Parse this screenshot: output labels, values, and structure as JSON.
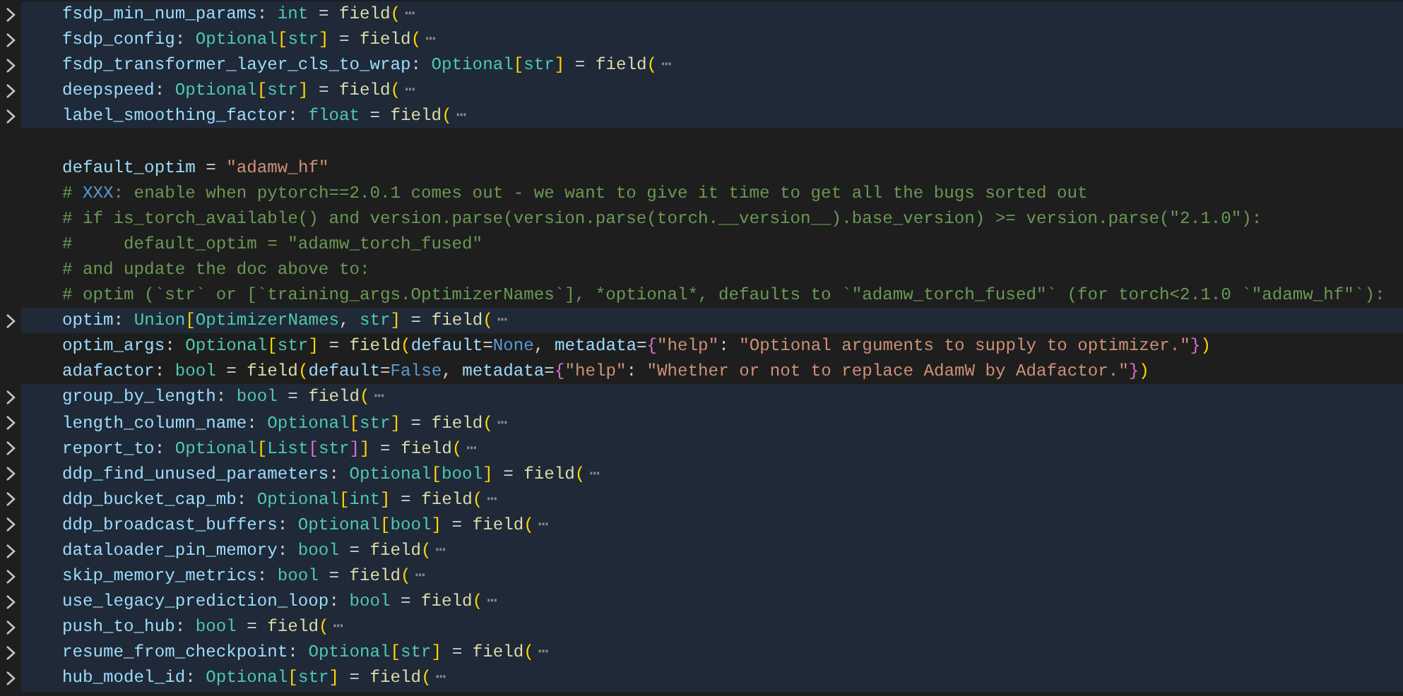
{
  "lines": [
    {
      "folded": true,
      "tokens": [
        {
          "kind": "v",
          "t": "fsdp_min_num_params"
        },
        {
          "kind": "o",
          "t": ": "
        },
        {
          "kind": "t",
          "t": "int"
        },
        {
          "kind": "o",
          "t": " = "
        },
        {
          "kind": "f",
          "t": "field"
        },
        {
          "kind": "b1",
          "t": "("
        },
        {
          "kind": "e",
          "t": "⋯"
        }
      ]
    },
    {
      "folded": true,
      "tokens": [
        {
          "kind": "v",
          "t": "fsdp_config"
        },
        {
          "kind": "o",
          "t": ": "
        },
        {
          "kind": "t",
          "t": "Optional"
        },
        {
          "kind": "b1",
          "t": "["
        },
        {
          "kind": "t",
          "t": "str"
        },
        {
          "kind": "b1",
          "t": "]"
        },
        {
          "kind": "o",
          "t": " = "
        },
        {
          "kind": "f",
          "t": "field"
        },
        {
          "kind": "b1",
          "t": "("
        },
        {
          "kind": "e",
          "t": "⋯"
        }
      ]
    },
    {
      "folded": true,
      "tokens": [
        {
          "kind": "v",
          "t": "fsdp_transformer_layer_cls_to_wrap"
        },
        {
          "kind": "o",
          "t": ": "
        },
        {
          "kind": "t",
          "t": "Optional"
        },
        {
          "kind": "b1",
          "t": "["
        },
        {
          "kind": "t",
          "t": "str"
        },
        {
          "kind": "b1",
          "t": "]"
        },
        {
          "kind": "o",
          "t": " = "
        },
        {
          "kind": "f",
          "t": "field"
        },
        {
          "kind": "b1",
          "t": "("
        },
        {
          "kind": "e",
          "t": "⋯"
        }
      ]
    },
    {
      "folded": true,
      "tokens": [
        {
          "kind": "v",
          "t": "deepspeed"
        },
        {
          "kind": "o",
          "t": ": "
        },
        {
          "kind": "t",
          "t": "Optional"
        },
        {
          "kind": "b1",
          "t": "["
        },
        {
          "kind": "t",
          "t": "str"
        },
        {
          "kind": "b1",
          "t": "]"
        },
        {
          "kind": "o",
          "t": " = "
        },
        {
          "kind": "f",
          "t": "field"
        },
        {
          "kind": "b1",
          "t": "("
        },
        {
          "kind": "e",
          "t": "⋯"
        }
      ]
    },
    {
      "folded": true,
      "tokens": [
        {
          "kind": "v",
          "t": "label_smoothing_factor"
        },
        {
          "kind": "o",
          "t": ": "
        },
        {
          "kind": "t",
          "t": "float"
        },
        {
          "kind": "o",
          "t": " = "
        },
        {
          "kind": "f",
          "t": "field"
        },
        {
          "kind": "b1",
          "t": "("
        },
        {
          "kind": "e",
          "t": "⋯"
        }
      ]
    },
    {
      "folded": false
    },
    {
      "folded": false,
      "tokens": [
        {
          "kind": "v",
          "t": "default_optim"
        },
        {
          "kind": "o",
          "t": " = "
        },
        {
          "kind": "s",
          "t": "\"adamw_hf\""
        }
      ]
    },
    {
      "folded": false,
      "tokens": [
        {
          "kind": "c",
          "t": "# "
        },
        {
          "kind": "tag",
          "t": "XXX"
        },
        {
          "kind": "c",
          "t": ": enable when pytorch==2.0.1 comes out - we want to give it time to get all the bugs sorted out"
        }
      ]
    },
    {
      "folded": false,
      "tokens": [
        {
          "kind": "c",
          "t": "# if is_torch_available() and version.parse(version.parse(torch.__version__).base_version) >= version.parse(\"2.1.0\"):"
        }
      ]
    },
    {
      "folded": false,
      "tokens": [
        {
          "kind": "c",
          "t": "#     default_optim = \"adamw_torch_fused\""
        }
      ]
    },
    {
      "folded": false,
      "tokens": [
        {
          "kind": "c",
          "t": "# and update the doc above to:"
        }
      ]
    },
    {
      "folded": false,
      "tokens": [
        {
          "kind": "c",
          "t": "# optim (`str` or [`training_args.OptimizerNames`], *optional*, defaults to `\"adamw_torch_fused\"` (for torch<2.1.0 `\"adamw_hf\"`):"
        }
      ]
    },
    {
      "folded": true,
      "tokens": [
        {
          "kind": "v",
          "t": "optim"
        },
        {
          "kind": "o",
          "t": ": "
        },
        {
          "kind": "t",
          "t": "Union"
        },
        {
          "kind": "b1",
          "t": "["
        },
        {
          "kind": "t",
          "t": "OptimizerNames"
        },
        {
          "kind": "o",
          "t": ", "
        },
        {
          "kind": "t",
          "t": "str"
        },
        {
          "kind": "b1",
          "t": "]"
        },
        {
          "kind": "o",
          "t": " = "
        },
        {
          "kind": "f",
          "t": "field"
        },
        {
          "kind": "b1",
          "t": "("
        },
        {
          "kind": "e",
          "t": "⋯"
        }
      ]
    },
    {
      "folded": false,
      "tokens": [
        {
          "kind": "v",
          "t": "optim_args"
        },
        {
          "kind": "o",
          "t": ": "
        },
        {
          "kind": "t",
          "t": "Optional"
        },
        {
          "kind": "b1",
          "t": "["
        },
        {
          "kind": "t",
          "t": "str"
        },
        {
          "kind": "b1",
          "t": "]"
        },
        {
          "kind": "o",
          "t": " = "
        },
        {
          "kind": "f",
          "t": "field"
        },
        {
          "kind": "b1",
          "t": "("
        },
        {
          "kind": "v",
          "t": "default"
        },
        {
          "kind": "o",
          "t": "="
        },
        {
          "kind": "kw",
          "t": "None"
        },
        {
          "kind": "o",
          "t": ", "
        },
        {
          "kind": "v",
          "t": "metadata"
        },
        {
          "kind": "o",
          "t": "="
        },
        {
          "kind": "b2",
          "t": "{"
        },
        {
          "kind": "s",
          "t": "\"help\""
        },
        {
          "kind": "o",
          "t": ": "
        },
        {
          "kind": "s",
          "t": "\"Optional arguments to supply to optimizer.\""
        },
        {
          "kind": "b2",
          "t": "}"
        },
        {
          "kind": "b1",
          "t": ")"
        }
      ]
    },
    {
      "folded": false,
      "tokens": [
        {
          "kind": "v",
          "t": "adafactor"
        },
        {
          "kind": "o",
          "t": ": "
        },
        {
          "kind": "t",
          "t": "bool"
        },
        {
          "kind": "o",
          "t": " = "
        },
        {
          "kind": "f",
          "t": "field"
        },
        {
          "kind": "b1",
          "t": "("
        },
        {
          "kind": "v",
          "t": "default"
        },
        {
          "kind": "o",
          "t": "="
        },
        {
          "kind": "kw",
          "t": "False"
        },
        {
          "kind": "o",
          "t": ", "
        },
        {
          "kind": "v",
          "t": "metadata"
        },
        {
          "kind": "o",
          "t": "="
        },
        {
          "kind": "b2",
          "t": "{"
        },
        {
          "kind": "s",
          "t": "\"help\""
        },
        {
          "kind": "o",
          "t": ": "
        },
        {
          "kind": "s",
          "t": "\"Whether or not to replace AdamW by Adafactor.\""
        },
        {
          "kind": "b2",
          "t": "}"
        },
        {
          "kind": "b1",
          "t": ")"
        }
      ]
    },
    {
      "folded": true,
      "tokens": [
        {
          "kind": "v",
          "t": "group_by_length"
        },
        {
          "kind": "o",
          "t": ": "
        },
        {
          "kind": "t",
          "t": "bool"
        },
        {
          "kind": "o",
          "t": " = "
        },
        {
          "kind": "f",
          "t": "field"
        },
        {
          "kind": "b1",
          "t": "("
        },
        {
          "kind": "e",
          "t": "⋯"
        }
      ]
    },
    {
      "folded": true,
      "tokens": [
        {
          "kind": "v",
          "t": "length_column_name"
        },
        {
          "kind": "o",
          "t": ": "
        },
        {
          "kind": "t",
          "t": "Optional"
        },
        {
          "kind": "b1",
          "t": "["
        },
        {
          "kind": "t",
          "t": "str"
        },
        {
          "kind": "b1",
          "t": "]"
        },
        {
          "kind": "o",
          "t": " = "
        },
        {
          "kind": "f",
          "t": "field"
        },
        {
          "kind": "b1",
          "t": "("
        },
        {
          "kind": "e",
          "t": "⋯"
        }
      ]
    },
    {
      "folded": true,
      "tokens": [
        {
          "kind": "v",
          "t": "report_to"
        },
        {
          "kind": "o",
          "t": ": "
        },
        {
          "kind": "t",
          "t": "Optional"
        },
        {
          "kind": "b1",
          "t": "["
        },
        {
          "kind": "t",
          "t": "List"
        },
        {
          "kind": "b2",
          "t": "["
        },
        {
          "kind": "t",
          "t": "str"
        },
        {
          "kind": "b2",
          "t": "]"
        },
        {
          "kind": "b1",
          "t": "]"
        },
        {
          "kind": "o",
          "t": " = "
        },
        {
          "kind": "f",
          "t": "field"
        },
        {
          "kind": "b1",
          "t": "("
        },
        {
          "kind": "e",
          "t": "⋯"
        }
      ]
    },
    {
      "folded": true,
      "tokens": [
        {
          "kind": "v",
          "t": "ddp_find_unused_parameters"
        },
        {
          "kind": "o",
          "t": ": "
        },
        {
          "kind": "t",
          "t": "Optional"
        },
        {
          "kind": "b1",
          "t": "["
        },
        {
          "kind": "t",
          "t": "bool"
        },
        {
          "kind": "b1",
          "t": "]"
        },
        {
          "kind": "o",
          "t": " = "
        },
        {
          "kind": "f",
          "t": "field"
        },
        {
          "kind": "b1",
          "t": "("
        },
        {
          "kind": "e",
          "t": "⋯"
        }
      ]
    },
    {
      "folded": true,
      "tokens": [
        {
          "kind": "v",
          "t": "ddp_bucket_cap_mb"
        },
        {
          "kind": "o",
          "t": ": "
        },
        {
          "kind": "t",
          "t": "Optional"
        },
        {
          "kind": "b1",
          "t": "["
        },
        {
          "kind": "t",
          "t": "int"
        },
        {
          "kind": "b1",
          "t": "]"
        },
        {
          "kind": "o",
          "t": " = "
        },
        {
          "kind": "f",
          "t": "field"
        },
        {
          "kind": "b1",
          "t": "("
        },
        {
          "kind": "e",
          "t": "⋯"
        }
      ]
    },
    {
      "folded": true,
      "tokens": [
        {
          "kind": "v",
          "t": "ddp_broadcast_buffers"
        },
        {
          "kind": "o",
          "t": ": "
        },
        {
          "kind": "t",
          "t": "Optional"
        },
        {
          "kind": "b1",
          "t": "["
        },
        {
          "kind": "t",
          "t": "bool"
        },
        {
          "kind": "b1",
          "t": "]"
        },
        {
          "kind": "o",
          "t": " = "
        },
        {
          "kind": "f",
          "t": "field"
        },
        {
          "kind": "b1",
          "t": "("
        },
        {
          "kind": "e",
          "t": "⋯"
        }
      ]
    },
    {
      "folded": true,
      "tokens": [
        {
          "kind": "v",
          "t": "dataloader_pin_memory"
        },
        {
          "kind": "o",
          "t": ": "
        },
        {
          "kind": "t",
          "t": "bool"
        },
        {
          "kind": "o",
          "t": " = "
        },
        {
          "kind": "f",
          "t": "field"
        },
        {
          "kind": "b1",
          "t": "("
        },
        {
          "kind": "e",
          "t": "⋯"
        }
      ]
    },
    {
      "folded": true,
      "tokens": [
        {
          "kind": "v",
          "t": "skip_memory_metrics"
        },
        {
          "kind": "o",
          "t": ": "
        },
        {
          "kind": "t",
          "t": "bool"
        },
        {
          "kind": "o",
          "t": " = "
        },
        {
          "kind": "f",
          "t": "field"
        },
        {
          "kind": "b1",
          "t": "("
        },
        {
          "kind": "e",
          "t": "⋯"
        }
      ]
    },
    {
      "folded": true,
      "tokens": [
        {
          "kind": "v",
          "t": "use_legacy_prediction_loop"
        },
        {
          "kind": "o",
          "t": ": "
        },
        {
          "kind": "t",
          "t": "bool"
        },
        {
          "kind": "o",
          "t": " = "
        },
        {
          "kind": "f",
          "t": "field"
        },
        {
          "kind": "b1",
          "t": "("
        },
        {
          "kind": "e",
          "t": "⋯"
        }
      ]
    },
    {
      "folded": true,
      "tokens": [
        {
          "kind": "v",
          "t": "push_to_hub"
        },
        {
          "kind": "o",
          "t": ": "
        },
        {
          "kind": "t",
          "t": "bool"
        },
        {
          "kind": "o",
          "t": " = "
        },
        {
          "kind": "f",
          "t": "field"
        },
        {
          "kind": "b1",
          "t": "("
        },
        {
          "kind": "e",
          "t": "⋯"
        }
      ]
    },
    {
      "folded": true,
      "tokens": [
        {
          "kind": "v",
          "t": "resume_from_checkpoint"
        },
        {
          "kind": "o",
          "t": ": "
        },
        {
          "kind": "t",
          "t": "Optional"
        },
        {
          "kind": "b1",
          "t": "["
        },
        {
          "kind": "t",
          "t": "str"
        },
        {
          "kind": "b1",
          "t": "]"
        },
        {
          "kind": "o",
          "t": " = "
        },
        {
          "kind": "f",
          "t": "field"
        },
        {
          "kind": "b1",
          "t": "("
        },
        {
          "kind": "e",
          "t": "⋯"
        }
      ]
    },
    {
      "folded": true,
      "tokens": [
        {
          "kind": "v",
          "t": "hub_model_id"
        },
        {
          "kind": "o",
          "t": ": "
        },
        {
          "kind": "t",
          "t": "Optional"
        },
        {
          "kind": "b1",
          "t": "["
        },
        {
          "kind": "t",
          "t": "str"
        },
        {
          "kind": "b1",
          "t": "]"
        },
        {
          "kind": "o",
          "t": " = "
        },
        {
          "kind": "f",
          "t": "field"
        },
        {
          "kind": "b1",
          "t": "("
        },
        {
          "kind": "e",
          "t": "⋯"
        }
      ]
    }
  ]
}
